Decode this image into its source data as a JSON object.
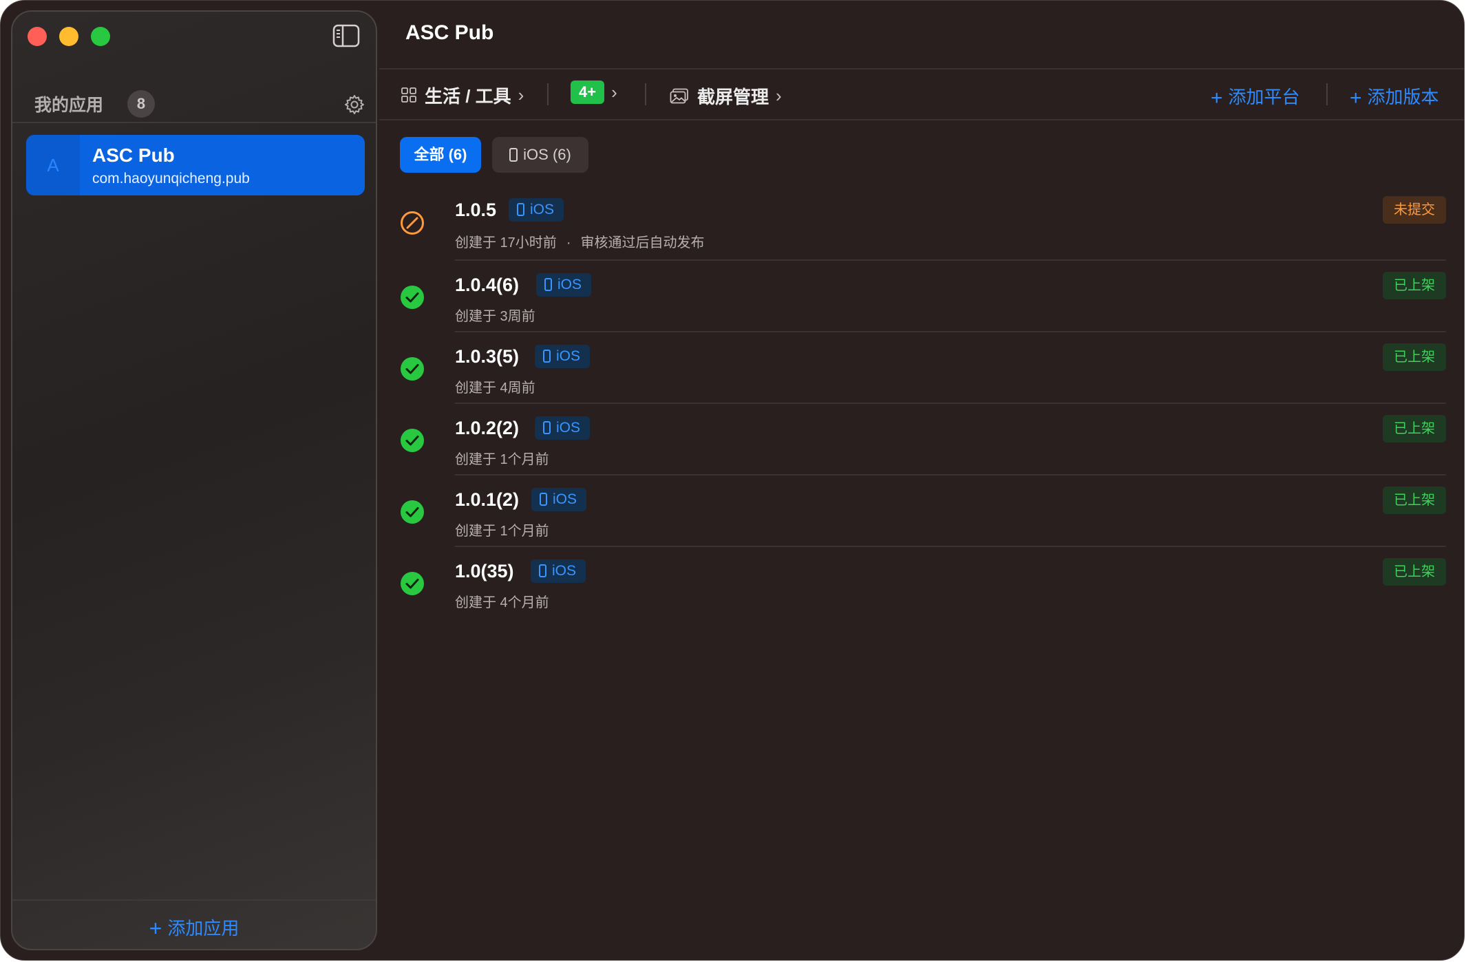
{
  "sidebar": {
    "title": "我的应用",
    "count": "8",
    "apps": [
      {
        "avatar": "A",
        "name": "ASC Pub",
        "bundle": "com.haoyunqicheng.pub",
        "selected": true
      }
    ],
    "add_app_label": "添加应用"
  },
  "main": {
    "title": "ASC Pub",
    "toolbar": {
      "category": "生活 / 工具",
      "age_rating": "4+",
      "screenshots": "截屏管理",
      "add_platform": "添加平台",
      "add_version": "添加版本"
    },
    "tabs": [
      {
        "label": "全部 (6)",
        "active": true
      },
      {
        "label": "iOS (6)",
        "active": false
      }
    ],
    "versions": [
      {
        "version": "1.0.5",
        "platform": "iOS",
        "created": "创建于 17小时前",
        "note": "审核通过后自动发布",
        "status": "未提交",
        "state": "pending"
      },
      {
        "version": "1.0.4(6)",
        "platform": "iOS",
        "created": "创建于 3周前",
        "note": "",
        "status": "已上架",
        "state": "live"
      },
      {
        "version": "1.0.3(5)",
        "platform": "iOS",
        "created": "创建于 4周前",
        "note": "",
        "status": "已上架",
        "state": "live"
      },
      {
        "version": "1.0.2(2)",
        "platform": "iOS",
        "created": "创建于 1个月前",
        "note": "",
        "status": "已上架",
        "state": "live"
      },
      {
        "version": "1.0.1(2)",
        "platform": "iOS",
        "created": "创建于 1个月前",
        "note": "",
        "status": "已上架",
        "state": "live"
      },
      {
        "version": "1.0(35)",
        "platform": "iOS",
        "created": "创建于 4个月前",
        "note": "",
        "status": "已上架",
        "state": "live"
      }
    ]
  },
  "colors": {
    "accent": "#0a6ef0",
    "link": "#2c8bff",
    "success": "#28c840",
    "warning": "#ff9a3a",
    "background": "#2a1f1f"
  },
  "icons": {
    "pending": "pencil-slash-circle-icon",
    "live": "checkmark-circle-icon",
    "platform": "iphone-icon"
  }
}
